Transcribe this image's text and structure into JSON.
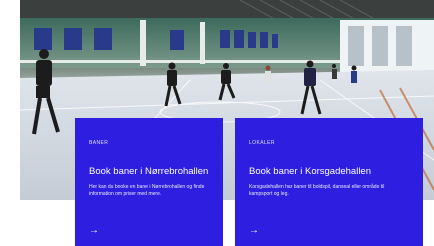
{
  "cards": [
    {
      "eyebrow": "BANER",
      "title": "Book baner i Nørrebrohallen",
      "description": "Her kan du booke en bane i Nørrebrohallen og finde information om priser med mere.",
      "arrow": "→"
    },
    {
      "eyebrow": "LOKALER",
      "title": "Book baner i Korsgadehallen",
      "description": "Korsgadehallen har baner til boldspil, danseal eller område til kampsport og leg.",
      "arrow": "→"
    }
  ],
  "colors": {
    "card_background": "#2d1ee0",
    "card_text": "#ffffff"
  }
}
